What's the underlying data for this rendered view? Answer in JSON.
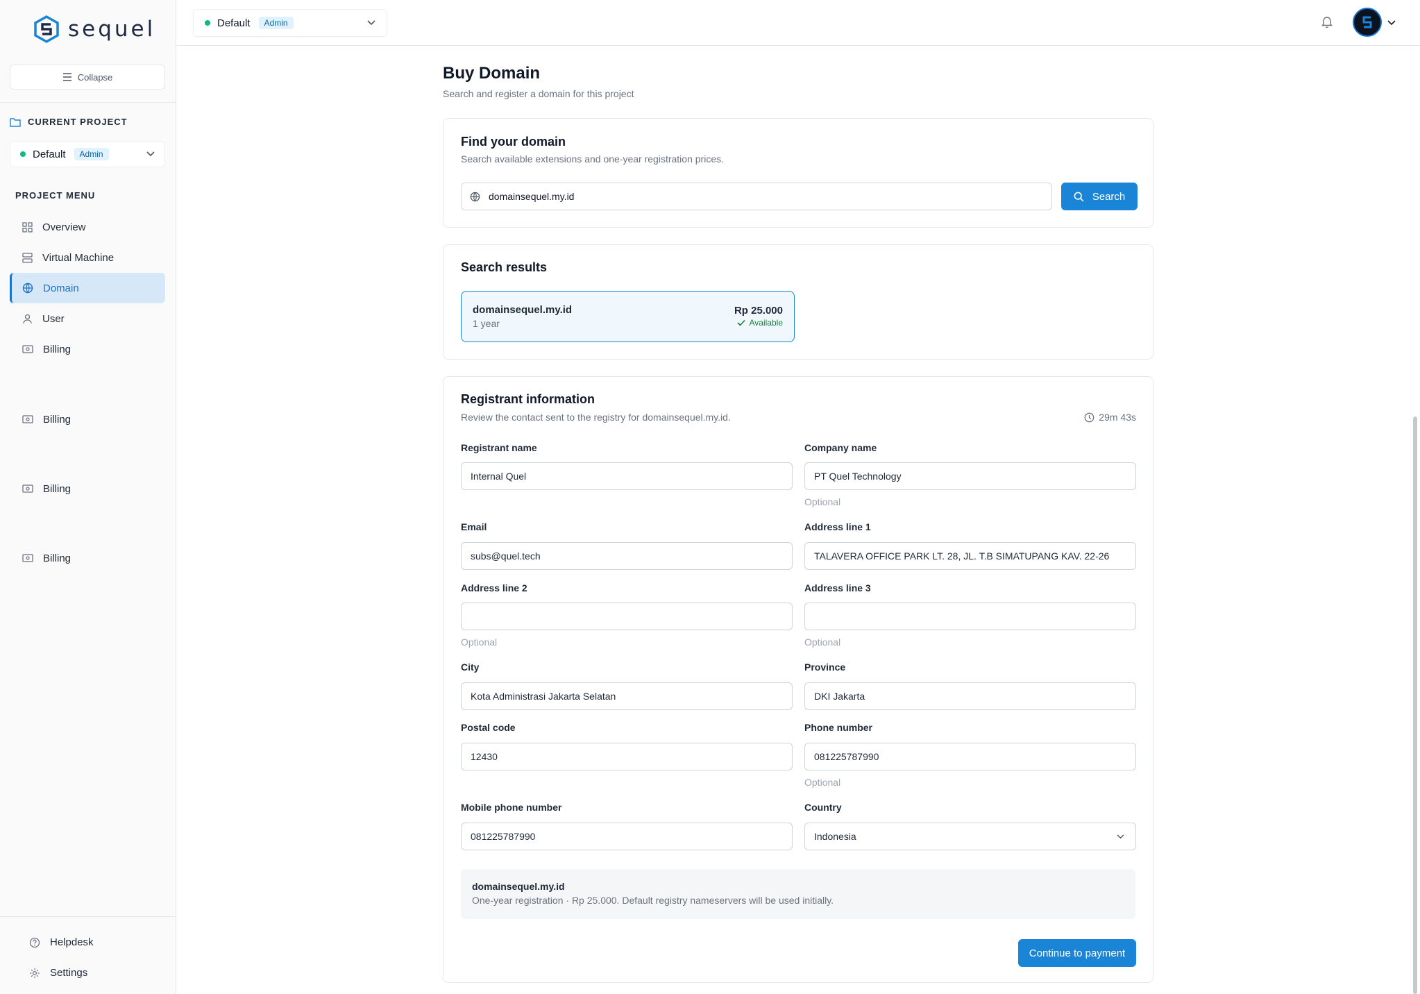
{
  "brand": {
    "name": "sequel",
    "color": "#1a85d6"
  },
  "sidebar": {
    "collapse_label": "Collapse",
    "current_project_heading": "CURRENT PROJECT",
    "project": {
      "name": "Default",
      "role": "Admin"
    },
    "menu_heading": "PROJECT MENU",
    "items": [
      {
        "label": "Overview",
        "icon": "grid-icon",
        "active": false
      },
      {
        "label": "Virtual Machine",
        "icon": "server-icon",
        "active": false
      },
      {
        "label": "Domain",
        "icon": "globe-icon",
        "active": true
      },
      {
        "label": "User",
        "icon": "user-icon",
        "active": false
      },
      {
        "label": "Billing",
        "icon": "billing-icon",
        "active": false
      },
      {
        "label": "Billing",
        "icon": "billing-icon",
        "active": false
      },
      {
        "label": "Billing",
        "icon": "billing-icon",
        "active": false
      },
      {
        "label": "Billing",
        "icon": "billing-icon",
        "active": false
      }
    ],
    "bottom": [
      {
        "label": "Helpdesk",
        "icon": "help-icon"
      },
      {
        "label": "Settings",
        "icon": "gear-icon"
      }
    ]
  },
  "topbar": {
    "project_name": "Default",
    "project_role": "Admin"
  },
  "page": {
    "title": "Buy Domain",
    "subtitle": "Search and register a domain for this project"
  },
  "find": {
    "title": "Find your domain",
    "description": "Search available extensions and one-year registration prices.",
    "query": "domainsequel.my.id",
    "button": "Search"
  },
  "results": {
    "title": "Search results",
    "items": [
      {
        "domain": "domainsequel.my.id",
        "term": "1 year",
        "price": "Rp 25.000",
        "status": "Available"
      }
    ]
  },
  "registrant": {
    "title": "Registrant information",
    "description": "Review the contact sent to the registry for domainsequel.my.id.",
    "timer": "29m 43s",
    "fields": {
      "registrant_name": {
        "label": "Registrant name",
        "value": "Internal Quel"
      },
      "company_name": {
        "label": "Company name",
        "value": "PT Quel Technology",
        "hint": "Optional"
      },
      "email": {
        "label": "Email",
        "value": "subs@quel.tech"
      },
      "address1": {
        "label": "Address line 1",
        "value": "TALAVERA OFFICE PARK LT. 28, JL. T.B SIMATUPANG KAV. 22-26"
      },
      "address2": {
        "label": "Address line 2",
        "value": "",
        "hint": "Optional"
      },
      "address3": {
        "label": "Address line 3",
        "value": "",
        "hint": "Optional"
      },
      "city": {
        "label": "City",
        "value": "Kota Administrasi Jakarta Selatan"
      },
      "province": {
        "label": "Province",
        "value": "DKI Jakarta"
      },
      "postal_code": {
        "label": "Postal code",
        "value": "12430"
      },
      "phone": {
        "label": "Phone number",
        "value": "081225787990",
        "hint": "Optional"
      },
      "mobile": {
        "label": "Mobile phone number",
        "value": "081225787990"
      },
      "country": {
        "label": "Country",
        "value": "Indonesia"
      }
    },
    "summary": {
      "domain": "domainsequel.my.id",
      "text": "One-year registration · Rp 25.000. Default registry nameservers will be used initially."
    },
    "continue_button": "Continue to payment"
  }
}
